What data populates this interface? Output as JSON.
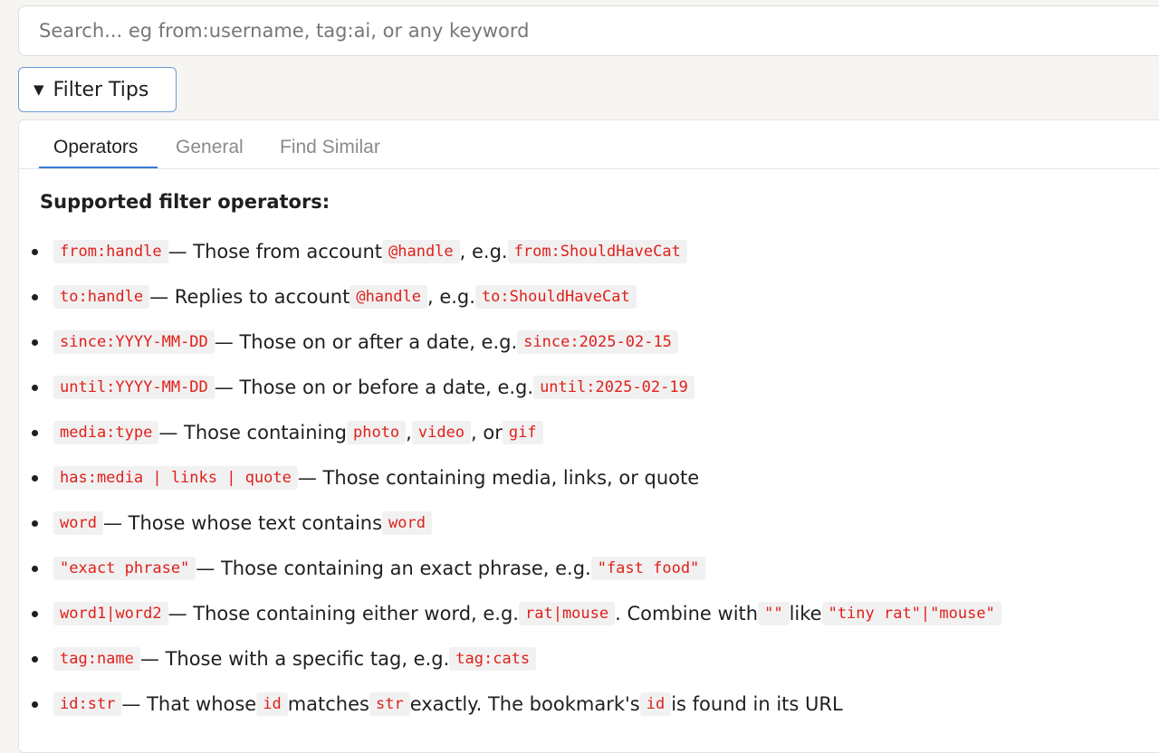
{
  "search": {
    "placeholder": "Search... eg from:username, tag:ai, or any keyword",
    "value": ""
  },
  "filter_toggle": {
    "caret": "▼",
    "label": "Filter Tips"
  },
  "tabs": [
    {
      "label": "Operators",
      "active": true
    },
    {
      "label": "General",
      "active": false
    },
    {
      "label": "Find Similar",
      "active": false
    }
  ],
  "heading": "Supported filter operators:",
  "operators": [
    {
      "c0": "from:handle",
      "t1": " — Those from account ",
      "c1": "@handle",
      "t2": ", e.g. ",
      "c2": "from:ShouldHaveCat"
    },
    {
      "c0": "to:handle",
      "t1": " — Replies to account ",
      "c1": "@handle",
      "t2": ", e.g. ",
      "c2": "to:ShouldHaveCat"
    },
    {
      "c0": "since:YYYY-MM-DD",
      "t1": " — Those on or after a date, e.g. ",
      "c1": "since:2025-02-15"
    },
    {
      "c0": "until:YYYY-MM-DD",
      "t1": " — Those on or before a date, e.g. ",
      "c1": "until:2025-02-19"
    },
    {
      "c0": "media:type",
      "t1": " — Those containing ",
      "c1": "photo",
      "t2": ", ",
      "c2": "video",
      "t3": ", or ",
      "c3": "gif"
    },
    {
      "c0": "has:media | links | quote",
      "t1": " — Those containing media, links, or quote"
    },
    {
      "c0": "word",
      "t1": " — Those whose text contains ",
      "c1": "word"
    },
    {
      "c0": "\"exact phrase\"",
      "t1": " — Those containing an exact phrase, e.g. ",
      "c1": "\"fast food\""
    },
    {
      "c0": "word1|word2",
      "t1": " — Those containing either word, e.g. ",
      "c1": "rat|mouse",
      "t2": ". Combine with ",
      "c2": "\"\"",
      "t3": " like ",
      "c3": "\"tiny rat\"|\"mouse\""
    },
    {
      "c0": "tag:name",
      "t1": " — Those with a specific tag, e.g. ",
      "c1": "tag:cats"
    },
    {
      "c0": "id:str",
      "t1": " — That whose ",
      "c1": "id",
      "t2": " matches ",
      "c2": "str",
      "t3": " exactly. The bookmark's",
      "c3": "id",
      "t4": " is found in its URL"
    }
  ]
}
